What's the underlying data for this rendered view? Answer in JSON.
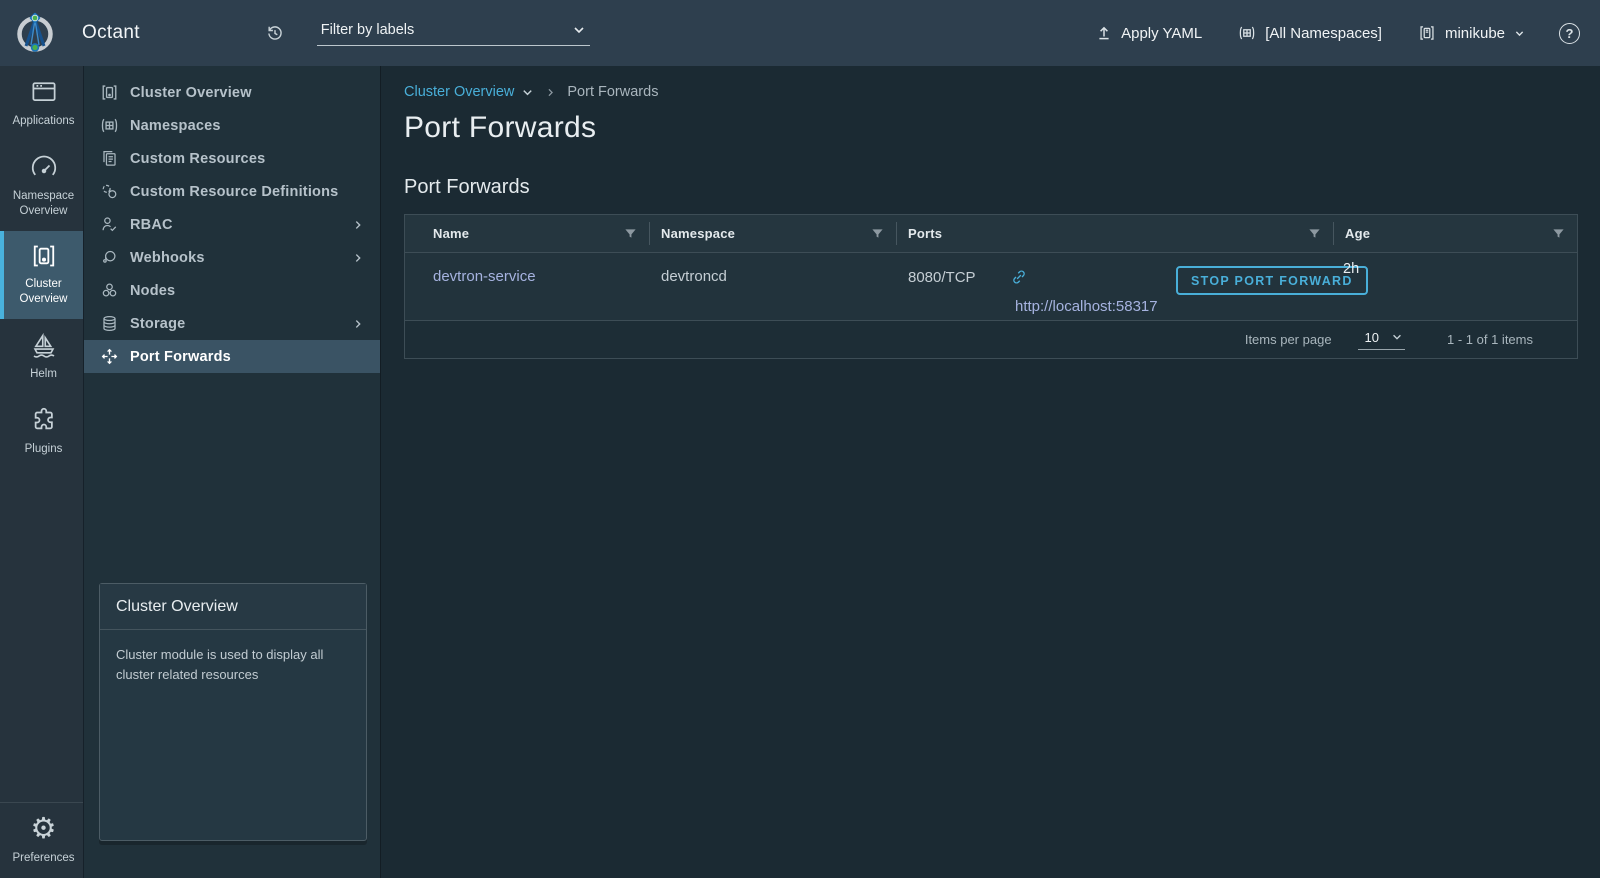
{
  "header": {
    "app_title": "Octant",
    "filter": {
      "placeholder": "Filter by labels"
    },
    "apply_yaml_label": "Apply YAML",
    "namespace_selector_label": "[All Namespaces]",
    "context_selector_label": "minikube"
  },
  "icons": {
    "gear_glyph": "⚙",
    "help_glyph": "?"
  },
  "rail": {
    "items": [
      {
        "label": "Applications"
      },
      {
        "label": "Namespace Overview"
      },
      {
        "label": "Cluster Overview"
      },
      {
        "label": "Helm"
      },
      {
        "label": "Plugins"
      }
    ],
    "preferences_label": "Preferences"
  },
  "sidebar": {
    "items": [
      {
        "label": "Cluster Overview"
      },
      {
        "label": "Namespaces"
      },
      {
        "label": "Custom Resources"
      },
      {
        "label": "Custom Resource Definitions"
      },
      {
        "label": "RBAC"
      },
      {
        "label": "Webhooks"
      },
      {
        "label": "Nodes"
      },
      {
        "label": "Storage"
      },
      {
        "label": "Port Forwards"
      }
    ],
    "info_card": {
      "title": "Cluster Overview",
      "description": "Cluster module is used to display all cluster related resources"
    }
  },
  "main": {
    "breadcrumb": {
      "parent": "Cluster Overview",
      "current": "Port Forwards"
    },
    "page_title": "Port Forwards",
    "section_title": "Port Forwards",
    "table": {
      "columns": [
        "Name",
        "Namespace",
        "Ports",
        "Age"
      ],
      "rows": [
        {
          "name": "devtron-service",
          "namespace": "devtroncd",
          "ports": "8080/TCP",
          "url": "http://localhost:58317",
          "action_label": "STOP PORT FORWARD",
          "age": "2h"
        }
      ],
      "footer": {
        "items_per_page_label": "Items per page",
        "items_per_page_value": "10",
        "range_label": "1 - 1 of 1 items"
      }
    }
  },
  "colors": {
    "accent": "#49afd9",
    "link": "#a6b3e0",
    "header_bg": "#2e3f4e",
    "sidebar_bg": "#20313a",
    "content_bg": "#1b2a33"
  }
}
